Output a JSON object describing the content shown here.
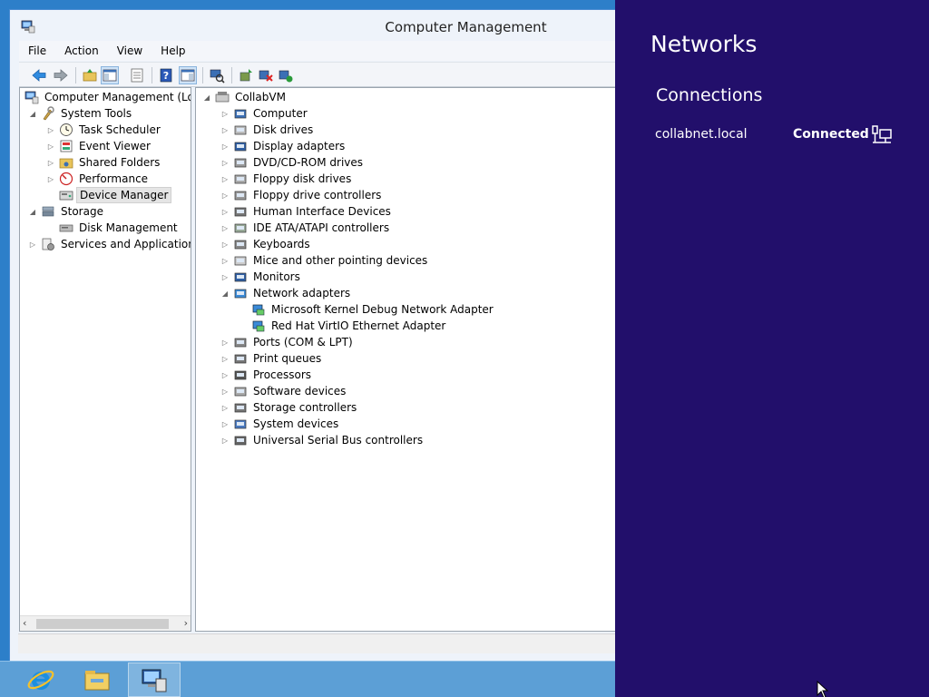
{
  "window": {
    "title": "Computer Management",
    "menu": [
      "File",
      "Action",
      "View",
      "Help"
    ]
  },
  "left_tree": [
    {
      "label": "Computer Management (Local",
      "icon": "computer-management-icon",
      "expanded": true
    },
    {
      "label": "System Tools",
      "icon": "system-tools-icon",
      "expanded": true
    },
    {
      "label": "Task Scheduler",
      "icon": "clock-icon",
      "expanded": false
    },
    {
      "label": "Event Viewer",
      "icon": "event-viewer-icon",
      "expanded": false
    },
    {
      "label": "Shared Folders",
      "icon": "shared-folder-icon",
      "expanded": false
    },
    {
      "label": "Performance",
      "icon": "performance-icon",
      "expanded": false
    },
    {
      "label": "Device Manager",
      "icon": "device-manager-icon",
      "selected": true
    },
    {
      "label": "Storage",
      "icon": "storage-icon",
      "expanded": true
    },
    {
      "label": "Disk Management",
      "icon": "disk-icon"
    },
    {
      "label": "Services and Applications",
      "icon": "services-icon",
      "expanded": false
    }
  ],
  "device_tree": {
    "root": "CollabVM",
    "categories": [
      "Computer",
      "Disk drives",
      "Display adapters",
      "DVD/CD-ROM drives",
      "Floppy disk drives",
      "Floppy drive controllers",
      "Human Interface Devices",
      "IDE ATA/ATAPI controllers",
      "Keyboards",
      "Mice and other pointing devices",
      "Monitors",
      "Network adapters",
      "Ports (COM & LPT)",
      "Print queues",
      "Processors",
      "Software devices",
      "Storage controllers",
      "System devices",
      "Universal Serial Bus controllers"
    ],
    "network_adapters": [
      "Microsoft Kernel Debug Network Adapter",
      "Red Hat VirtIO Ethernet Adapter"
    ]
  },
  "charm": {
    "title": "Networks",
    "section": "Connections",
    "network_name": "collabnet.local",
    "network_status": "Connected",
    "bg_color": "#220f6b"
  },
  "taskbar": {
    "items": [
      "internet-explorer-icon",
      "file-explorer-icon",
      "computer-management-icon"
    ]
  },
  "scroll": {
    "left": "‹",
    "right": "›"
  }
}
